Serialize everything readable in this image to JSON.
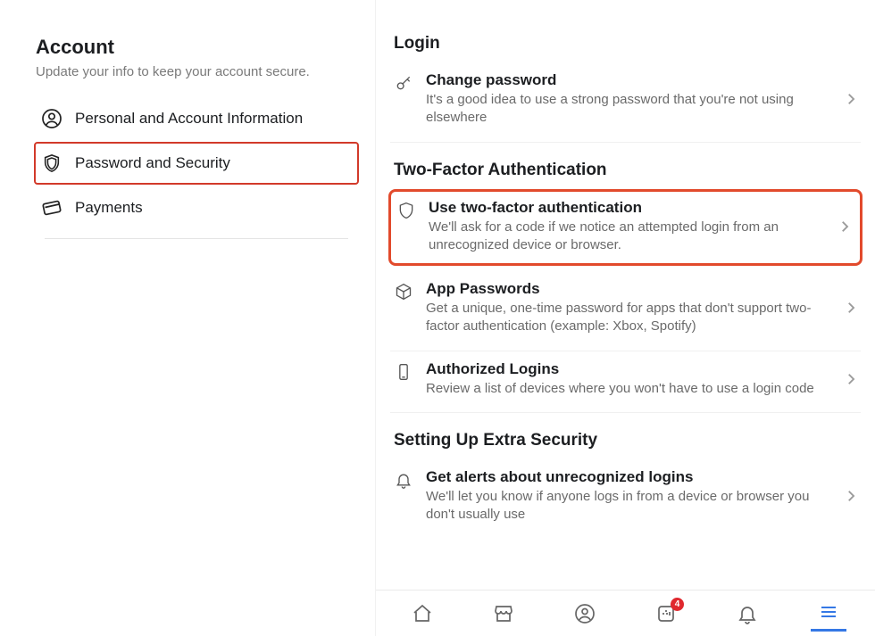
{
  "left": {
    "title": "Account",
    "subtitle": "Update your info to keep your account secure.",
    "items": [
      {
        "label": "Personal and Account Information"
      },
      {
        "label": "Password and Security"
      },
      {
        "label": "Payments"
      }
    ]
  },
  "right": {
    "sections": [
      {
        "title": "Login",
        "rows": [
          {
            "title": "Change password",
            "desc": "It's a good idea to use a strong password that you're not using elsewhere"
          }
        ]
      },
      {
        "title": "Two-Factor Authentication",
        "rows": [
          {
            "title": "Use two-factor authentication",
            "desc": "We'll ask for a code if we notice an attempted login from an unrecognized device or browser."
          },
          {
            "title": "App Passwords",
            "desc": "Get a unique, one-time password for apps that don't support two-factor authentication (example: Xbox, Spotify)"
          },
          {
            "title": "Authorized Logins",
            "desc": "Review a list of devices where you won't have to use a login code"
          }
        ]
      },
      {
        "title": "Setting Up Extra Security",
        "rows": [
          {
            "title": "Get alerts about unrecognized logins",
            "desc": "We'll let you know if anyone logs in from a device or browser you don't usually use"
          }
        ]
      }
    ]
  },
  "nav": {
    "badge_count": "4"
  }
}
